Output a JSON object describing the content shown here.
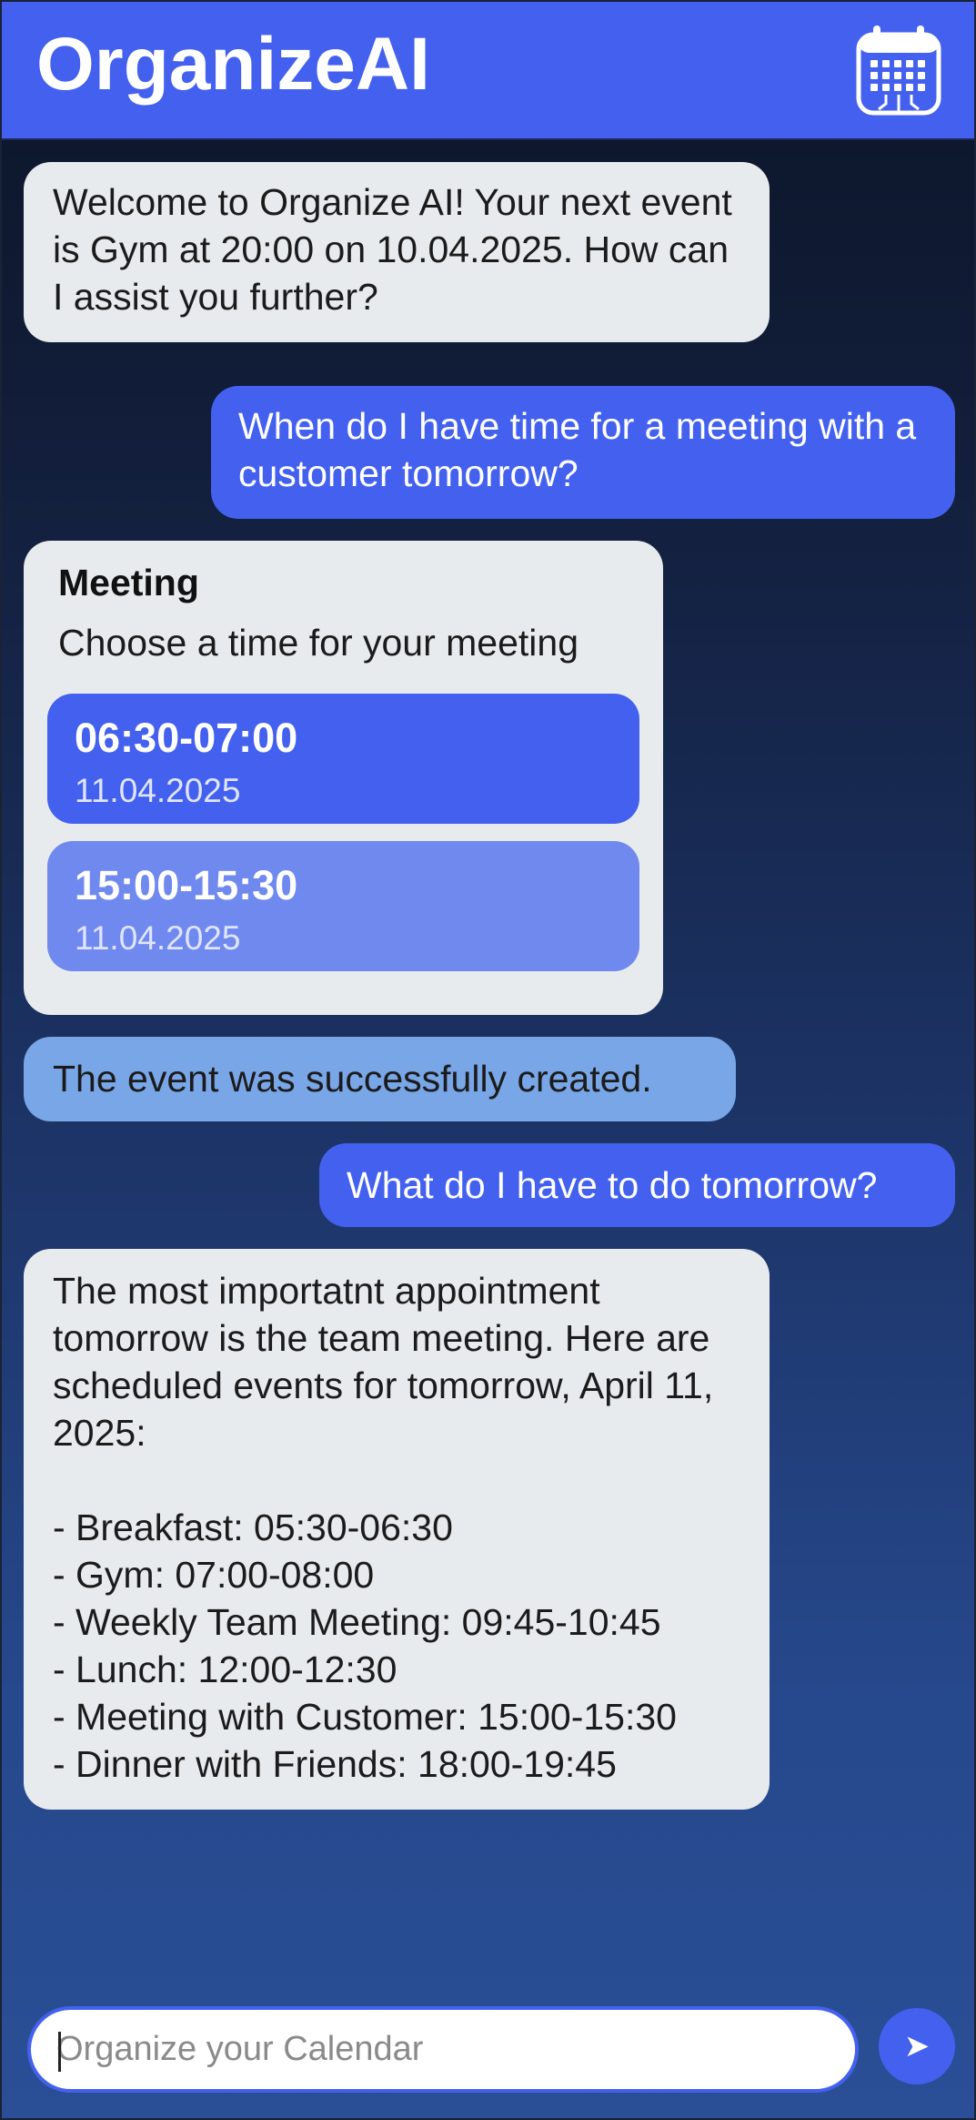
{
  "header": {
    "title": "OrganizeAI",
    "icon": "calendar-icon"
  },
  "chat": {
    "messages": [
      {
        "role": "assistant",
        "text": "Welcome to Organize AI! Your next event is Gym at 20:00 on 10.04.2025. How can I assist you further?"
      },
      {
        "role": "user",
        "text": "When do I have time for a meeting with a customer tomorrow?"
      },
      {
        "role": "assistant-card",
        "title": "Meeting",
        "subtitle": "Choose a time for your meeting",
        "slots": [
          {
            "time": "06:30-07:00",
            "date": "11.04.2025",
            "selected": true
          },
          {
            "time": "15:00-15:30",
            "date": "11.04.2025",
            "selected": false
          }
        ]
      },
      {
        "role": "status",
        "text": "The event was successfully created."
      },
      {
        "role": "user",
        "text": "What do I have to do tomorrow?"
      },
      {
        "role": "assistant",
        "text": "The most importatnt appointment tomorrow is the team meeting. Here are scheduled events for tomorrow, April 11, 2025:\n\n- Breakfast: 05:30-06:30\n- Gym: 07:00-08:00\n- Weekly Team Meeting: 09:45-10:45\n- Lunch: 12:00-12:30\n- Meeting with Customer: 15:00-15:30\n- Dinner with Friends: 18:00-19:45"
      }
    ]
  },
  "composer": {
    "placeholder": "Organize your Calendar",
    "value": "",
    "send_icon": "send-icon"
  },
  "colors": {
    "accent": "#4361ee",
    "accent_light": "#7089ef",
    "bot_bubble": "#e8ebee",
    "status_bubble": "#78a6e6",
    "background_top": "#0c1426",
    "background_bottom": "#2a4f96"
  }
}
